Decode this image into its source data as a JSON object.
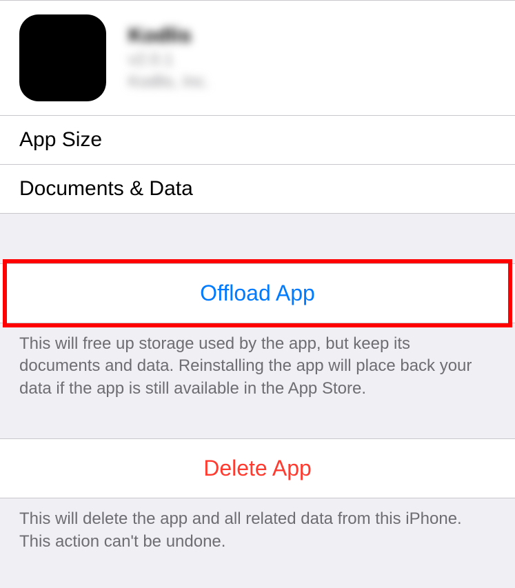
{
  "app": {
    "name": "Kodlis",
    "version": "v2.0.1",
    "vendor": "Kodlis, Inc."
  },
  "rows": {
    "app_size_label": "App Size",
    "documents_label": "Documents & Data"
  },
  "offload": {
    "button": "Offload App",
    "note": "This will free up storage used by the app, but keep its documents and data. Reinstalling the app will place back your data if the app is still available in the App Store."
  },
  "delete": {
    "button": "Delete App",
    "note": "This will delete the app and all related data from this iPhone. This action can't be undone."
  }
}
